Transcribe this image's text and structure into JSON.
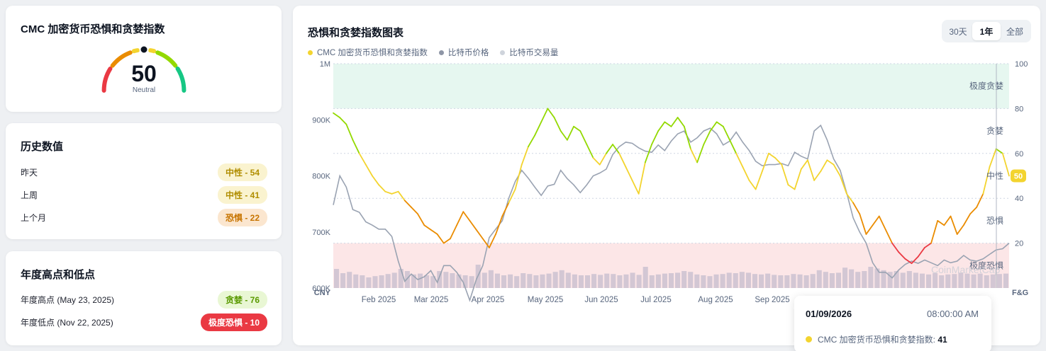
{
  "gauge": {
    "title": "CMC 加密货币恐惧和贪婪指数",
    "value": "50",
    "label": "Neutral",
    "segment_colors": [
      "#ea3943",
      "#ea8c00",
      "#f3d42f",
      "#93d900",
      "#16c784"
    ]
  },
  "history": {
    "title": "历史数值",
    "rows": [
      {
        "label": "昨天",
        "value": "中性 - 54",
        "bg": "#faf3cf",
        "color": "#b08d00"
      },
      {
        "label": "上周",
        "value": "中性 - 41",
        "bg": "#faf3cf",
        "color": "#b08d00"
      },
      {
        "label": "上个月",
        "value": "恐惧 - 22",
        "bg": "#fbe6cf",
        "color": "#c77400"
      }
    ]
  },
  "yearly": {
    "title": "年度高点和低点",
    "rows": [
      {
        "label": "年度高点 (May 23, 2025)",
        "value": "贪婪 - 76",
        "bg": "#e9f7d4",
        "color": "#5a9a00"
      },
      {
        "label": "年度低点 (Nov 22, 2025)",
        "value": "极度恐惧 - 10",
        "bg": "#ea3943",
        "color": "#ffffff"
      }
    ]
  },
  "chart": {
    "title": "恐惧和贪婪指数图表",
    "tabs": [
      "30天",
      "1年",
      "全部"
    ],
    "active_tab": "1年",
    "legend": [
      {
        "label": "CMC 加密货币恐惧和贪婪指数",
        "color": "#f3d42f"
      },
      {
        "label": "比特币价格",
        "color": "#8e96a6"
      },
      {
        "label": "比特币交易量",
        "color": "#cfd4dc"
      }
    ],
    "left_axis_unit": "CNY",
    "right_axis_unit": "F&G",
    "current_badge": "50",
    "watermark": "CoinMarketCap"
  },
  "tooltip": {
    "date": "01/09/2026",
    "time": "08:00:00 AM",
    "label": "CMC 加密货币恐惧和贪婪指数:",
    "value": "41"
  },
  "chart_data": {
    "type": "line",
    "x_ticks": [
      "Feb 2025",
      "Mar 2025",
      "Apr 2025",
      "May 2025",
      "Jun 2025",
      "Jul 2025",
      "Aug 2025",
      "Sep 2025"
    ],
    "y_left_ticks": [
      "1M",
      "900K",
      "800K",
      "700K",
      "600K"
    ],
    "y_left_range": [
      600000,
      1000000
    ],
    "y_right_ticks": [
      "100",
      "80",
      "60",
      "40",
      "20"
    ],
    "y_right_range": [
      0,
      100
    ],
    "zones": [
      {
        "label": "极度贪婪",
        "from": 80,
        "to": 100,
        "color": "#e6f7f0"
      },
      {
        "label": "贪婪",
        "from": 60,
        "to": 80
      },
      {
        "label": "中性",
        "from": 40,
        "to": 60
      },
      {
        "label": "恐惧",
        "from": 20,
        "to": 40
      },
      {
        "label": "极度恐惧",
        "from": 0,
        "to": 20,
        "color": "#fce6e7"
      }
    ],
    "series": [
      {
        "name": "CMC 加密货币恐惧和贪婪指数",
        "axis": "right",
        "values": [
          78,
          76,
          73,
          66,
          60,
          55,
          50,
          46,
          43,
          42,
          43,
          39,
          36,
          33,
          28,
          26,
          24,
          20,
          22,
          28,
          34,
          30,
          26,
          22,
          18,
          24,
          32,
          38,
          44,
          55,
          63,
          68,
          74,
          80,
          76,
          70,
          66,
          72,
          70,
          64,
          58,
          55,
          60,
          64,
          60,
          54,
          48,
          42,
          56,
          64,
          70,
          74,
          72,
          76,
          72,
          62,
          56,
          64,
          70,
          74,
          72,
          66,
          60,
          54,
          48,
          44,
          52,
          60,
          58,
          55,
          46,
          44,
          53,
          57,
          48,
          52,
          57,
          55,
          50,
          42,
          38,
          33,
          24,
          28,
          32,
          26,
          20,
          16,
          13,
          11,
          14,
          18,
          20,
          30,
          28,
          32,
          24,
          28,
          33,
          36,
          42,
          54,
          62,
          60,
          50
        ]
      },
      {
        "name": "比特币价格",
        "axis": "left",
        "values": [
          748000,
          800000,
          780000,
          740000,
          735000,
          718000,
          712000,
          705000,
          705000,
          692000,
          648000,
          612000,
          625000,
          615000,
          620000,
          631000,
          610000,
          640000,
          640000,
          628000,
          610000,
          578000,
          615000,
          640000,
          690000,
          705000,
          720000,
          760000,
          790000,
          810000,
          796000,
          780000,
          765000,
          782000,
          785000,
          810000,
          795000,
          784000,
          770000,
          784000,
          800000,
          805000,
          812000,
          838000,
          852000,
          860000,
          858000,
          850000,
          844000,
          842000,
          855000,
          845000,
          862000,
          875000,
          880000,
          860000,
          868000,
          880000,
          885000,
          875000,
          855000,
          862000,
          878000,
          860000,
          845000,
          826000,
          818000,
          820000,
          820000,
          822000,
          818000,
          842000,
          835000,
          830000,
          880000,
          890000,
          864000,
          830000,
          810000,
          770000,
          725000,
          700000,
          680000,
          645000,
          628000,
          628000,
          618000,
          632000,
          642000,
          648000,
          644000,
          650000,
          645000,
          640000,
          650000,
          645000,
          648000,
          658000,
          650000,
          648000,
          652000,
          660000,
          668000,
          670000,
          680000
        ]
      },
      {
        "name": "比特币交易量",
        "axis": "left",
        "type": "bar",
        "values": [
          0.45,
          0.35,
          0.38,
          0.32,
          0.3,
          0.25,
          0.28,
          0.3,
          0.33,
          0.36,
          0.45,
          0.4,
          0.32,
          0.34,
          0.3,
          0.28,
          0.4,
          0.38,
          0.35,
          0.32,
          0.3,
          0.28,
          0.55,
          0.36,
          0.42,
          0.34,
          0.3,
          0.32,
          0.28,
          0.35,
          0.33,
          0.3,
          0.32,
          0.34,
          0.38,
          0.42,
          0.36,
          0.32,
          0.3,
          0.3,
          0.33,
          0.31,
          0.34,
          0.33,
          0.3,
          0.32,
          0.36,
          0.31,
          0.5,
          0.3,
          0.32,
          0.34,
          0.35,
          0.36,
          0.4,
          0.38,
          0.32,
          0.3,
          0.28,
          0.32,
          0.33,
          0.36,
          0.35,
          0.38,
          0.36,
          0.33,
          0.32,
          0.34,
          0.31,
          0.3,
          0.3,
          0.33,
          0.32,
          0.3,
          0.33,
          0.42,
          0.38,
          0.35,
          0.36,
          0.48,
          0.44,
          0.38,
          0.4,
          0.5,
          0.46,
          0.42,
          0.38,
          0.4,
          0.36,
          0.4,
          0.36,
          0.34,
          0.32,
          0.35,
          0.3,
          0.32,
          0.33,
          0.36,
          0.34,
          0.32,
          0.34,
          0.3,
          0.32,
          0.33,
          0.34
        ]
      }
    ],
    "grid": true
  }
}
